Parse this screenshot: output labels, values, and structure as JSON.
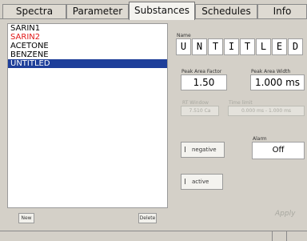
{
  "tabs": [
    "Spectra",
    "Parameter",
    "Substances",
    "Schedules",
    "Info"
  ],
  "active_tab": "Substances",
  "substances": [
    {
      "name": "SARIN1",
      "color": "#000000"
    },
    {
      "name": "SARIN2",
      "color": "#e01818"
    },
    {
      "name": "ACETONE",
      "color": "#000000"
    },
    {
      "name": "BENZENE",
      "color": "#000000"
    },
    {
      "name": "UNTITLED",
      "color": "#ffffff",
      "selected": true
    }
  ],
  "list_buttons": {
    "new": "New",
    "delete": "Delete"
  },
  "name_label": "Name",
  "name_letters": [
    "U",
    "N",
    "T",
    "I",
    "T",
    "L",
    "E",
    "D"
  ],
  "peak_area_factor": {
    "label": "Peak Area Factor",
    "value": "1.50"
  },
  "peak_area_width": {
    "label": "Peak Area Width",
    "value": "1.000 ms"
  },
  "rt_window": {
    "label": "RT Window",
    "value": "7.510 Ca"
  },
  "time_limit": {
    "label": "Time limit",
    "value": "0.000 ms - 1.000 ms"
  },
  "negative_label": "negative",
  "active_label": "active",
  "alarm": {
    "label": "Alarm",
    "value": "Off"
  },
  "apply_label": "Apply"
}
